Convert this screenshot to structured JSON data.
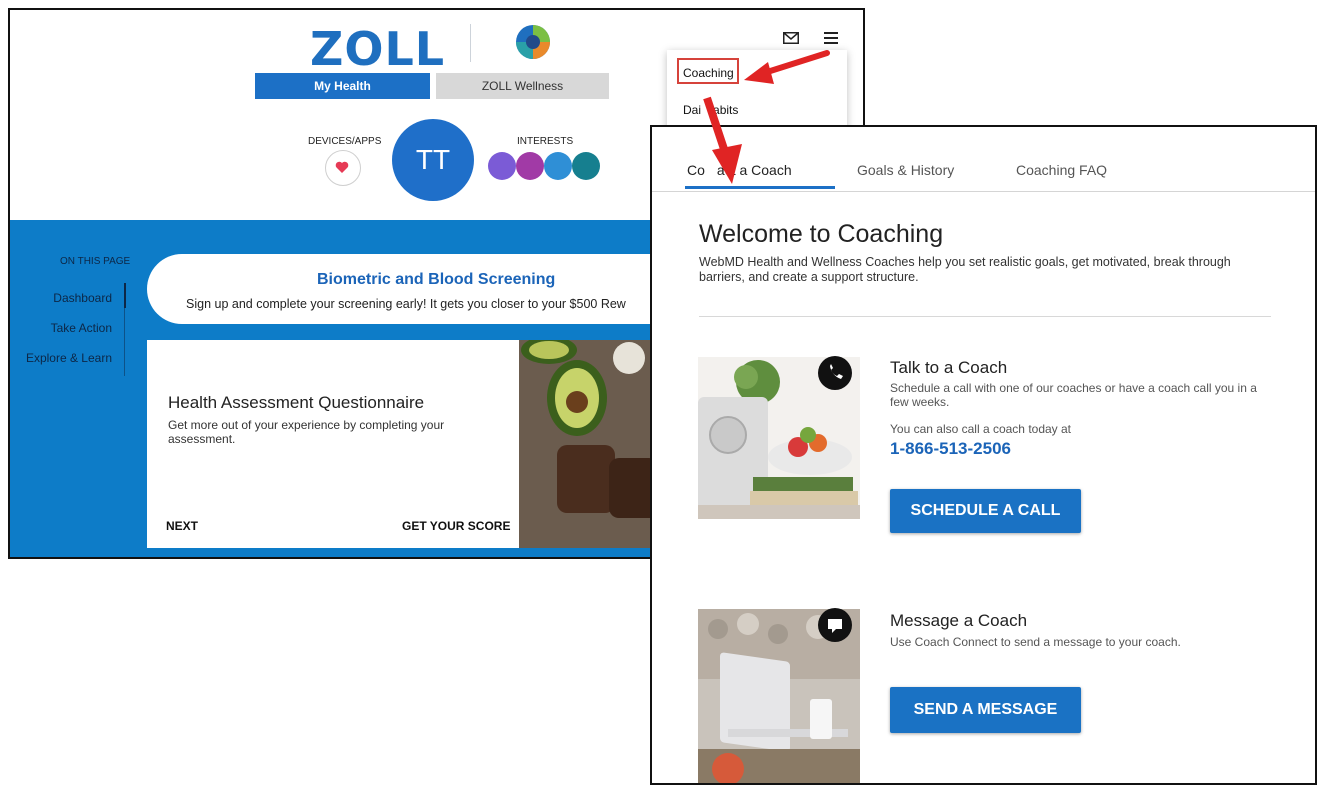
{
  "back_window": {
    "brand": "ZOLL",
    "tabs": [
      {
        "label": "My Health",
        "active": true
      },
      {
        "label": "ZOLL Wellness",
        "active": false
      }
    ],
    "devices_label": "DEVICES/APPS",
    "avatar_initials": "TT",
    "interests_label": "INTERESTS",
    "side_nav": {
      "heading": "ON THIS PAGE",
      "items": [
        "Dashboard",
        "Take Action",
        "Explore & Learn"
      ]
    },
    "biometric_card": {
      "title": "Biometric and Blood Screening",
      "subtitle": "Sign up and complete your screening early! It gets you closer to your $500 Rew"
    },
    "hra_card": {
      "title": "Health Assessment Questionnaire",
      "description": "Get more out of your experience by completing your assessment.",
      "next_label": "NEXT",
      "score_label": "GET YOUR SCORE"
    },
    "dropdown_menu": {
      "items": [
        "Coaching",
        "Daily Habits"
      ],
      "daily_visible": "Dai",
      "daily_tail": "abits"
    }
  },
  "front_window": {
    "tabs": [
      "Contact a Coach",
      "Goals & History",
      "Coaching FAQ"
    ],
    "tab_contact_head": "Co",
    "tab_contact_tail": "act a Coach",
    "welcome_title": "Welcome to Coaching",
    "intro": "WebMD Health and Wellness Coaches help you set realistic goals, get motivated, break through barriers, and create a support structure.",
    "talk": {
      "title": "Talk to a Coach",
      "description": "Schedule a call with one of our coaches or have a coach call you in a few weeks.",
      "also_call": "You can also call a coach today at",
      "phone": "1-866-513-2506",
      "button": "SCHEDULE A CALL"
    },
    "message": {
      "title": "Message a Coach",
      "description": "Use Coach Connect to send a message to your coach.",
      "button": "SEND A MESSAGE"
    }
  },
  "colors": {
    "brand_blue": "#1c70c6",
    "band_blue": "#0d7cc8",
    "annotation_red": "#e02424"
  }
}
